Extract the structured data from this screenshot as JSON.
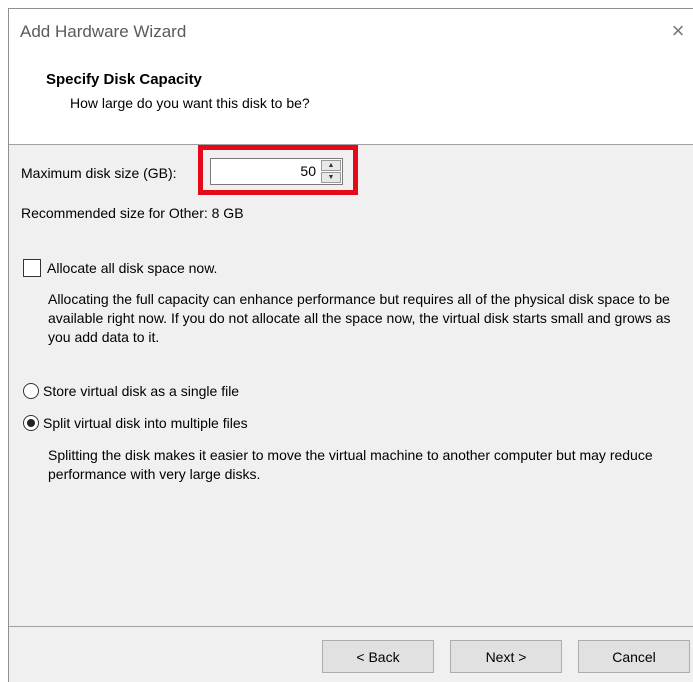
{
  "window": {
    "title": "Add Hardware Wizard",
    "close_glyph": "×"
  },
  "header": {
    "title": "Specify Disk Capacity",
    "subtitle": "How large do you want this disk to be?"
  },
  "disk_size": {
    "label": "Maximum disk size (GB):",
    "value": "50",
    "recommended": "Recommended size for Other: 8 GB",
    "highlight_color": "#e5091a"
  },
  "allocate": {
    "label": "Allocate all disk space now.",
    "checked": false,
    "description": "Allocating the full capacity can enhance performance but requires all of the physical disk space to be available right now. If you do not allocate all the space now, the virtual disk starts small and grows as you add data to it."
  },
  "storage": {
    "options": [
      {
        "label": "Store virtual disk as a single file",
        "selected": false
      },
      {
        "label": "Split virtual disk into multiple files",
        "selected": true
      }
    ],
    "description": "Splitting the disk makes it easier to move the virtual machine to another computer but may reduce performance with very large disks."
  },
  "buttons": {
    "back": "< Back",
    "next": "Next >",
    "cancel": "Cancel"
  }
}
